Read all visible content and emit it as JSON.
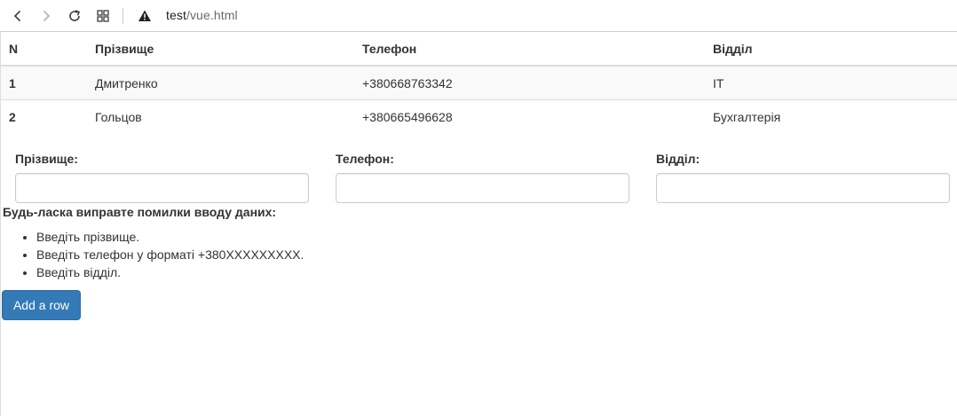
{
  "browser": {
    "address_host": "test",
    "address_path": "/vue.html"
  },
  "table": {
    "headers": [
      "N",
      "Прізвище",
      "Телефон",
      "Відділ"
    ],
    "rows": [
      [
        "1",
        "Дмитренко",
        "+380668763342",
        "IT"
      ],
      [
        "2",
        "Гольцов",
        "+380665496628",
        "Бухгалтерія"
      ]
    ]
  },
  "form": {
    "surname_label": "Прізвище:",
    "phone_label": "Телефон:",
    "department_label": "Відділ:",
    "surname_value": "",
    "phone_value": "",
    "department_value": ""
  },
  "errors": {
    "title": "Будь-ласка виправте помилки вводу даних:",
    "items": [
      "Введіть прізвище.",
      "Введіть телефон у форматі +380XXXXXXXXX.",
      "Введіть відділ."
    ]
  },
  "actions": {
    "add_row_label": "Add a row"
  },
  "colors": {
    "primary_button": "#337ab7",
    "striped_row": "#f9f9f9"
  }
}
